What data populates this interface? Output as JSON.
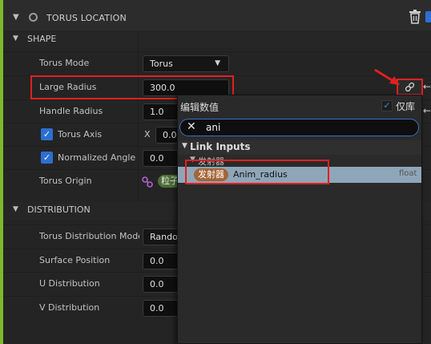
{
  "header": {
    "title": "TORUS LOCATION",
    "icons": [
      "chevron-down-icon",
      "circle-icon",
      "trash-icon"
    ]
  },
  "sections": [
    {
      "title": "SHAPE"
    },
    {
      "title": "DISTRIBUTION"
    }
  ],
  "shape_rows": [
    {
      "label": "Torus Mode",
      "value": "Torus",
      "kind": "combo"
    },
    {
      "label": "Large Radius",
      "value": "300.0",
      "kind": "number"
    },
    {
      "label": "Handle Radius",
      "value": "1.0",
      "kind": "number"
    },
    {
      "label": "Torus Axis",
      "value": "0.0",
      "axis_prefix": "X",
      "kind": "checkbox-number",
      "checked": true
    },
    {
      "label": "Normalized Angle /",
      "value": "0.0",
      "kind": "checkbox-number",
      "checked": true
    },
    {
      "label": "Torus Origin",
      "value": "粒子",
      "kind": "link"
    }
  ],
  "distribution_rows": [
    {
      "label": "Torus Distribution Mode",
      "value": "Rando",
      "kind": "combo"
    },
    {
      "label": "Surface Position",
      "value": "0.0",
      "kind": "number"
    },
    {
      "label": "U Distribution",
      "value": "0.0",
      "kind": "number"
    },
    {
      "label": "V Distribution",
      "value": "0.0",
      "kind": "number"
    }
  ],
  "popup": {
    "title": "编辑数值",
    "only_library_label": "仅库",
    "only_library_checked": true,
    "search_value": "ani",
    "category": "Link Inputs",
    "subcategory": "发射器",
    "item": {
      "badge": "发射器",
      "name": "Anim_radius",
      "type": "float"
    }
  },
  "colors": {
    "accent": "#7fb82a",
    "checkbox": "#2d6fd0",
    "highlight": "#e02020",
    "selected_row": "#8fa6b8",
    "badge": "#a46437"
  }
}
